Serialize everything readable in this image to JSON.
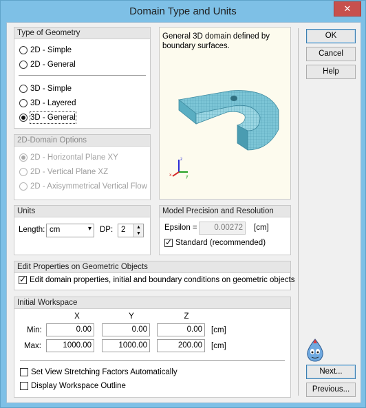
{
  "window": {
    "title": "Domain Type and Units",
    "close_glyph": "✕"
  },
  "geometry": {
    "header": "Type of Geometry",
    "options": [
      "2D - Simple",
      "2D - General",
      "3D - Simple",
      "3D - Layered",
      "3D - General"
    ],
    "selected": "3D - General"
  },
  "domain2d": {
    "header": "2D-Domain Options",
    "options": [
      "2D - Horizontal Plane XY",
      "2D - Vertical Plane XZ",
      "2D - Axisymmetrical Vertical Flow"
    ],
    "selected": "2D - Horizontal Plane XY"
  },
  "preview": {
    "description": "General 3D domain defined by boundary surfaces.",
    "axes": [
      "x",
      "y",
      "z"
    ]
  },
  "units": {
    "header": "Units",
    "length_label": "Length:",
    "length_value": "cm",
    "dp_label": "DP:",
    "dp_value": "2"
  },
  "precision": {
    "header": "Model Precision and Resolution",
    "epsilon_label": "Epsilon =",
    "epsilon_value": "0.00272",
    "epsilon_unit": "[cm]",
    "standard_label": "Standard (recommended)",
    "standard_checked": true
  },
  "edit_props": {
    "header": "Edit Properties on Geometric Objects",
    "checkbox_label": "Edit domain properties, initial and boundary conditions on geometric objects",
    "checked": true
  },
  "workspace": {
    "header": "Initial Workspace",
    "col_x": "X",
    "col_y": "Y",
    "col_z": "Z",
    "min_label": "Min:",
    "max_label": "Max:",
    "min": {
      "x": "0.00",
      "y": "0.00",
      "z": "0.00"
    },
    "max": {
      "x": "1000.00",
      "y": "1000.00",
      "z": "200.00"
    },
    "unit": "[cm]",
    "stretch_label": "Set View Stretching Factors Automatically",
    "outline_label": "Display Workspace Outline"
  },
  "buttons": {
    "ok": "OK",
    "cancel": "Cancel",
    "help": "Help",
    "next": "Next...",
    "previous": "Previous..."
  },
  "colors": {
    "titlebar": "#7ec0e6",
    "model": "#7cc5d6",
    "close": "#c7504d"
  }
}
